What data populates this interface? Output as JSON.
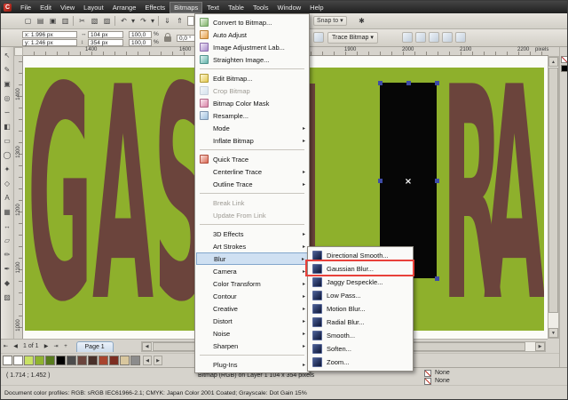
{
  "app": {
    "name": "CorelDRAW"
  },
  "menu_bar": {
    "items": [
      "File",
      "Edit",
      "View",
      "Layout",
      "Arrange",
      "Effects",
      "Bitmaps",
      "Text",
      "Table",
      "Tools",
      "Window",
      "Help"
    ],
    "active_item": "Bitmaps"
  },
  "toolbar": {
    "dropdown_arrow": "▾",
    "buttons": [
      {
        "name": "new-document",
        "glyph": "▢"
      },
      {
        "name": "open",
        "glyph": "▤"
      },
      {
        "name": "save",
        "glyph": "▣"
      },
      {
        "name": "print",
        "glyph": "▥"
      },
      {
        "name": "cut",
        "glyph": "✂"
      },
      {
        "name": "copy",
        "glyph": "▧"
      },
      {
        "name": "paste",
        "glyph": "▨"
      },
      {
        "name": "undo",
        "glyph": "↶"
      },
      {
        "name": "redo",
        "glyph": "↷"
      },
      {
        "name": "import",
        "glyph": "⇓"
      },
      {
        "name": "export",
        "glyph": "⇑"
      }
    ],
    "snap_to_label": "Snap to",
    "options_glyph": "✱"
  },
  "property_bar": {
    "x_field": "x: 1.996 px",
    "y_field": "y: 1.246 px",
    "width_arrow": "↔",
    "height_arrow": "↕",
    "width_field": "104 px",
    "height_field": "354 px",
    "scale_h_field": "100,0",
    "scale_v_field": "100,0",
    "percent_suffix": "%",
    "angle_field": "0,0 °",
    "trace_bitmap_label": "Trace Bitmap"
  },
  "rulers": {
    "horizontal_labels": [
      "1400",
      "1600",
      "1900",
      "2000",
      "2100",
      "2200"
    ],
    "unit_label": "pixels",
    "vertical_labels": [
      "1400",
      "1300",
      "1200",
      "1100",
      "1000"
    ]
  },
  "toolbox": {
    "tools": [
      {
        "name": "pick-tool",
        "glyph": "↖"
      },
      {
        "name": "shape-tool",
        "glyph": "✎"
      },
      {
        "name": "crop-tool",
        "glyph": "▣"
      },
      {
        "name": "zoom-tool",
        "glyph": "◎"
      },
      {
        "name": "freehand-tool",
        "glyph": "∽"
      },
      {
        "name": "smart-fill-tool",
        "glyph": "◧"
      },
      {
        "name": "rectangle-tool",
        "glyph": "▭"
      },
      {
        "name": "ellipse-tool",
        "glyph": "◯"
      },
      {
        "name": "polygon-tool",
        "glyph": "✦"
      },
      {
        "name": "basic-shapes-tool",
        "glyph": "◇"
      },
      {
        "name": "text-tool",
        "glyph": "A"
      },
      {
        "name": "table-tool",
        "glyph": "▦"
      },
      {
        "name": "dimension-tool",
        "glyph": "↔"
      },
      {
        "name": "blend-tool",
        "glyph": "▱"
      },
      {
        "name": "eyedropper-tool",
        "glyph": "✏"
      },
      {
        "name": "outline-pen-tool",
        "glyph": "✒"
      },
      {
        "name": "fill-tool",
        "glyph": "◆"
      },
      {
        "name": "interactive-fill-tool",
        "glyph": "▨"
      }
    ]
  },
  "bitmaps_menu": {
    "submenu_arrow": "▸",
    "items": [
      {
        "label": "Convert to Bitmap..."
      },
      {
        "label": "Auto Adjust"
      },
      {
        "label": "Image Adjustment Lab..."
      },
      {
        "label": "Straighten Image..."
      },
      {
        "label": "Edit Bitmap..."
      },
      {
        "label": "Crop Bitmap",
        "disabled": true
      },
      {
        "label": "Bitmap Color Mask"
      },
      {
        "label": "Resample..."
      },
      {
        "label": "Mode",
        "submenu": true
      },
      {
        "label": "Inflate Bitmap",
        "submenu": true
      },
      {
        "label": "Quick Trace"
      },
      {
        "label": "Centerline Trace",
        "submenu": true
      },
      {
        "label": "Outline Trace",
        "submenu": true
      },
      {
        "label": "Break Link",
        "disabled": true
      },
      {
        "label": "Update From Link",
        "disabled": true
      },
      {
        "label": "3D Effects",
        "submenu": true
      },
      {
        "label": "Art Strokes",
        "submenu": true
      },
      {
        "label": "Blur",
        "submenu": true,
        "highlighted": true
      },
      {
        "label": "Camera",
        "submenu": true
      },
      {
        "label": "Color Transform",
        "submenu": true
      },
      {
        "label": "Contour",
        "submenu": true
      },
      {
        "label": "Creative",
        "submenu": true
      },
      {
        "label": "Distort",
        "submenu": true
      },
      {
        "label": "Noise",
        "submenu": true
      },
      {
        "label": "Sharpen",
        "submenu": true
      },
      {
        "label": "Plug-Ins",
        "submenu": true
      }
    ]
  },
  "blur_submenu": {
    "items": [
      {
        "label": "Directional Smooth..."
      },
      {
        "label": "Gaussian Blur...",
        "annotated": true
      },
      {
        "label": "Jaggy Despeckle..."
      },
      {
        "label": "Low Pass..."
      },
      {
        "label": "Motion Blur..."
      },
      {
        "label": "Radial Blur..."
      },
      {
        "label": "Smooth..."
      },
      {
        "label": "Soften..."
      },
      {
        "label": "Zoom..."
      }
    ]
  },
  "canvas": {
    "background_color": "#8eb02c",
    "letter_color": "#6b443c",
    "letters_left": "GAS",
    "letters_right": "RA",
    "selection_center_mark": "×"
  },
  "page_controls": {
    "counter": "1 of 1",
    "page_tab": "Page 1"
  },
  "document_palette": {
    "colors": [
      "none",
      "#ffffff",
      "#c9e265",
      "#8fb32f",
      "#587c1d",
      "#000000",
      "#4c4c4c",
      "#6b443c",
      "#49302a",
      "#a8442e",
      "#7c2d21",
      "#d9c79e",
      "#8c8c8c"
    ]
  },
  "right_palette": {
    "colors": [
      "none",
      "#000000"
    ]
  },
  "status_bar": {
    "cursor_coords": "( 1.714 ; 1.452 )",
    "selection_info": "Bitmap (RGB) on Layer 1   104 x 354 pixels",
    "fill_status": "None",
    "outline_status": "None"
  },
  "color_profiles_bar": {
    "text": "Document color profiles: RGB: sRGB IEC61966-2.1; CMYK: Japan Color 2001 Coated; Grayscale: Dot Gain 15%"
  }
}
